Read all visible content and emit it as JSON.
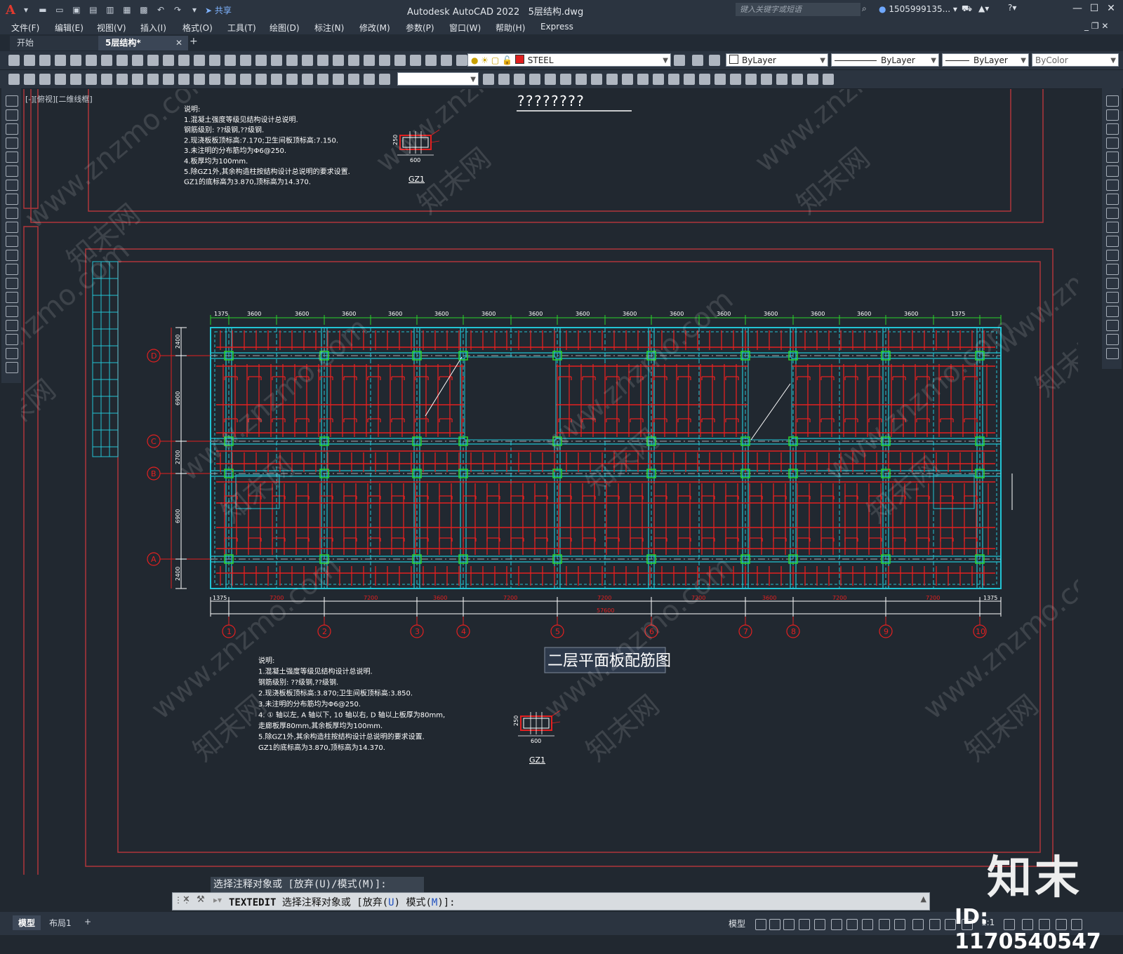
{
  "app": {
    "product": "Autodesk AutoCAD 2022",
    "filename": "5层结构.dwg",
    "share_label": "共享",
    "search_placeholder": "键入关键字或短语",
    "user": "1505999135...",
    "logo_letter": "A"
  },
  "menu": [
    "文件(F)",
    "编辑(E)",
    "视图(V)",
    "插入(I)",
    "格式(O)",
    "工具(T)",
    "绘图(D)",
    "标注(N)",
    "修改(M)",
    "参数(P)",
    "窗口(W)",
    "帮助(H)",
    "Express"
  ],
  "tabs": {
    "start": "开始",
    "active": "5层结构*"
  },
  "properties": {
    "layer": "STEEL",
    "layer_color": "#e01f1f",
    "color": "ByLayer",
    "linetype": "ByLayer",
    "lineweight": "ByLayer",
    "plotstyle": "ByColor"
  },
  "viewport_label": "[-][俯视][二维线框]",
  "drawing": {
    "top_title": "????????",
    "top_notes": [
      "说明:",
      "1.混凝土强度等级见结构设计总说明.",
      "  钢筋级别: ??级钢,??级钢.",
      "2.现浇板板顶标高:7.170;卫生间板顶标高:7.150.",
      "3.未注明的分布筋均为Φ6@250.",
      "4.板厚均为100mm.",
      "5.除GZ1外,其余构造柱按结构设计总说明的要求设置.",
      "  GZ1的底标高为3.870,顶标高为14.370."
    ],
    "column_label": "GZ1",
    "column_dim_w": "600",
    "column_dim_h": "250",
    "plan_title": "二层平面板配筋图",
    "bottom_notes": [
      "说明:",
      "1.混凝土强度等级见结构设计总说明.",
      "  钢筋级别: ??级钢,??级钢.",
      "2.现浇板板顶标高:3.870;卫生间板顶标高:3.850.",
      "3.未注明的分布筋均为Φ6@250.",
      "4. ① 轴以左, A 轴以下, 10 轴以右, D 轴以上板厚为80mm,",
      "   走廊板厚80mm,其余板厚均为100mm.",
      "5.除GZ1外,其余构造柱按结构设计总说明的要求设置.",
      "  GZ1的底标高为3.870,顶标高为14.370."
    ],
    "top_dims": [
      "1375",
      "3600",
      "3600",
      "3600",
      "3600",
      "3600",
      "3600",
      "3600",
      "3600",
      "3600",
      "3600",
      "3600",
      "3600",
      "3600",
      "3600",
      "3600",
      "1375"
    ],
    "bottom_dims": [
      "1375",
      "7200",
      "7200",
      "3600",
      "7200",
      "7200",
      "7200",
      "3600",
      "7200",
      "7200",
      "1375"
    ],
    "total_dim": "57600",
    "axes_x": [
      "1",
      "2",
      "3",
      "4",
      "5",
      "6",
      "7",
      "8",
      "9",
      "10"
    ],
    "axes_y": [
      "D",
      "C",
      "B",
      "A"
    ],
    "left_dims": [
      "2400",
      "6900",
      "2700",
      "6900",
      "2400"
    ]
  },
  "command": {
    "history": "选择注释对象或 [放弃(U)/模式(M)]:",
    "name": "TEXTEDIT",
    "prompt_pre": " 选择注释对象或 [放弃(",
    "opt1": "U",
    "prompt_mid": ") 模式(",
    "opt2": "M",
    "prompt_post": ")]:"
  },
  "status": {
    "model_tab": "模型",
    "layout_tab": "布局1",
    "space": "模型",
    "scale": "1:1"
  },
  "watermark": {
    "logo": "知末",
    "id": "ID: 1170540547",
    "url": "www.znzmo.com",
    "cn": "知末网"
  }
}
